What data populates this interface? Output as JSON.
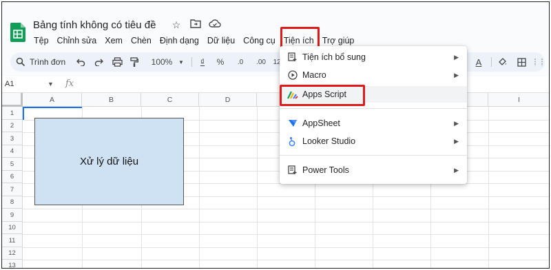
{
  "doc": {
    "title": "Bảng tính không có tiêu đề"
  },
  "menu": {
    "items": [
      "Tệp",
      "Chỉnh sửa",
      "Xem",
      "Chèn",
      "Định dạng",
      "Dữ liệu",
      "Công cụ",
      "Tiện ích",
      "Trợ giúp"
    ]
  },
  "toolbar": {
    "search_label": "Trình đơn",
    "zoom": "100%",
    "currency": "₫",
    "percent": "%",
    "dec_decrease": ".0",
    "dec_increase": ".00",
    "number_fmt": "12",
    "text_color": "A"
  },
  "formula": {
    "namebox": "A1",
    "fx": "fx"
  },
  "grid": {
    "columns": [
      "A",
      "B",
      "C",
      "D",
      "E",
      "F",
      "G",
      "H",
      "I"
    ],
    "rows": [
      "1",
      "2",
      "3",
      "4",
      "5",
      "6",
      "7",
      "8",
      "9",
      "10",
      "11",
      "12",
      "13"
    ]
  },
  "shape": {
    "text": "Xử lý dữ liệu"
  },
  "dropdown": {
    "items": [
      {
        "label": "Tiện ích bổ sung",
        "icon": "addons-icon",
        "submenu": true
      },
      {
        "label": "Macro",
        "icon": "macro-play-icon",
        "submenu": true
      },
      {
        "label": "Apps Script",
        "icon": "apps-script-icon",
        "submenu": false
      },
      {
        "label": "AppSheet",
        "icon": "appsheet-icon",
        "submenu": true
      },
      {
        "label": "Looker Studio",
        "icon": "looker-studio-icon",
        "submenu": true
      },
      {
        "label": "Power Tools",
        "icon": "power-tools-icon",
        "submenu": true
      }
    ]
  },
  "colors": {
    "highlight": "#e11919",
    "sheets_green": "#0f9d58",
    "selection": "#1a73e8",
    "shape_fill": "#cfe2f3"
  }
}
